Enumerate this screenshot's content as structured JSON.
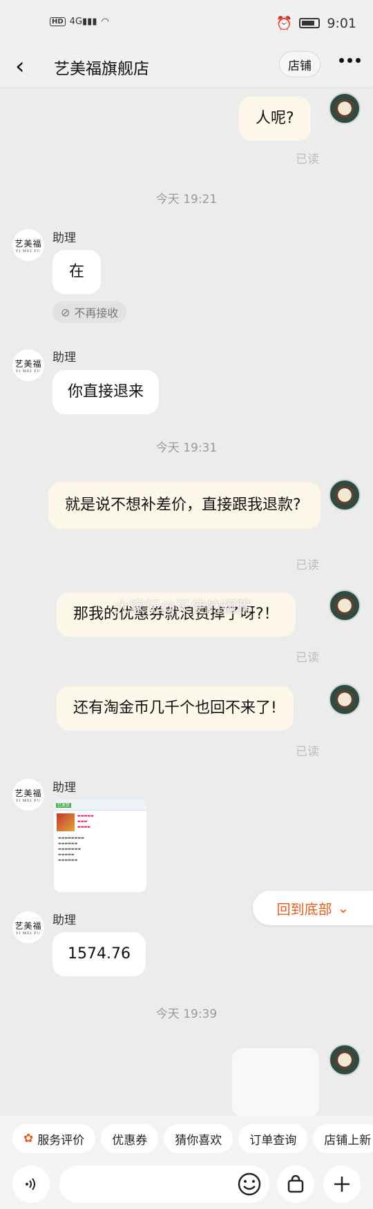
{
  "status_bar": {
    "left": "HD 4G",
    "time": "9:01"
  },
  "header": {
    "title": "艺美福旗舰店",
    "shop_button": "店铺"
  },
  "avatars": {
    "shop_line1": "艺美福",
    "shop_line2": "YI MEI FU"
  },
  "messages": {
    "m1": "人呢?",
    "m1_read": "已读",
    "time1": "今天   19:21",
    "sender1": "助理",
    "m2": "在",
    "no_receive": "不再接收",
    "sender2": "助理",
    "m3": "你直接退来",
    "time2": "今天   19:31",
    "m4": "就是说不想补差价，直接跟我退款?",
    "m4_read": "已读",
    "m5": "那我的优惠券就浪费掉了呀?！",
    "m5_read": "已读",
    "m6": "还有淘金币几千个也回不来了!",
    "m6_read": "已读",
    "sender3": "助理",
    "sender4": "助理",
    "m7": "1574.76",
    "time3": "今天   19:39"
  },
  "watermark": "大家坛@天使的翅膀",
  "back_to_bottom": "回到底部",
  "toolbar": {
    "chips": [
      "服务评价",
      "优惠券",
      "猜你喜欢",
      "订单查询",
      "店铺上新"
    ]
  },
  "input": {
    "placeholder": ""
  },
  "colors": {
    "accent": "#e25e1f",
    "my_bubble": "#fdf7e9",
    "background": "#ececec"
  }
}
